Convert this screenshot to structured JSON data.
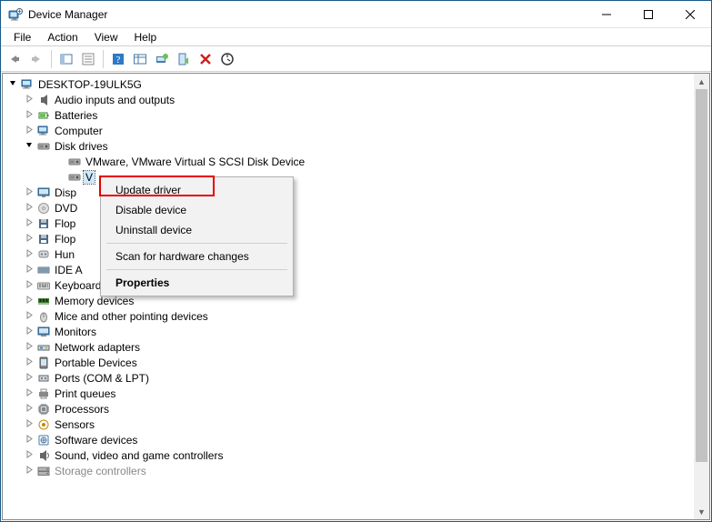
{
  "window": {
    "title": "Device Manager"
  },
  "menubar": {
    "items": [
      "File",
      "Action",
      "View",
      "Help"
    ]
  },
  "toolbar": {
    "buttons": [
      {
        "name": "back-icon"
      },
      {
        "name": "forward-icon"
      },
      {
        "sep": true
      },
      {
        "name": "show-hidden-icon"
      },
      {
        "name": "properties-icon"
      },
      {
        "sep": true
      },
      {
        "name": "help-icon"
      },
      {
        "name": "view-icon"
      },
      {
        "name": "monitor-icon"
      },
      {
        "name": "device-manager-icon"
      },
      {
        "name": "delete-icon"
      },
      {
        "name": "scan-refresh-icon"
      }
    ]
  },
  "tree": {
    "root": "DESKTOP-19ULK5G",
    "items": [
      {
        "label": "Audio inputs and outputs",
        "icon": "audio"
      },
      {
        "label": "Batteries",
        "icon": "battery"
      },
      {
        "label": "Computer",
        "icon": "computer"
      },
      {
        "label": "Disk drives",
        "icon": "disk",
        "open": true,
        "children": [
          {
            "label": "VMware, VMware Virtual S SCSI Disk Device",
            "icon": "disk"
          },
          {
            "label": "V",
            "icon": "disk",
            "selected": true
          }
        ]
      },
      {
        "label": "Disp",
        "icon": "display",
        "truncated": true
      },
      {
        "label": "DVD",
        "icon": "dvd",
        "truncated": true
      },
      {
        "label": "Flop",
        "icon": "floppy",
        "truncated": true
      },
      {
        "label": "Flop",
        "icon": "floppy",
        "truncated": true
      },
      {
        "label": "Hun",
        "icon": "hid",
        "truncated": true
      },
      {
        "label": "IDE A",
        "icon": "ide",
        "truncated": true
      },
      {
        "label": "Keyboards",
        "icon": "keyboard"
      },
      {
        "label": "Memory devices",
        "icon": "memory"
      },
      {
        "label": "Mice and other pointing devices",
        "icon": "mouse"
      },
      {
        "label": "Monitors",
        "icon": "monitor"
      },
      {
        "label": "Network adapters",
        "icon": "network"
      },
      {
        "label": "Portable Devices",
        "icon": "portable"
      },
      {
        "label": "Ports (COM & LPT)",
        "icon": "port"
      },
      {
        "label": "Print queues",
        "icon": "printer"
      },
      {
        "label": "Processors",
        "icon": "cpu"
      },
      {
        "label": "Sensors",
        "icon": "sensor"
      },
      {
        "label": "Software devices",
        "icon": "software"
      },
      {
        "label": "Sound, video and game controllers",
        "icon": "sound"
      },
      {
        "label": "Storage controllers",
        "icon": "storage",
        "cut": true
      }
    ]
  },
  "context_menu": {
    "items": [
      {
        "label": "Update driver",
        "highlight": true
      },
      {
        "label": "Disable device"
      },
      {
        "label": "Uninstall device"
      },
      {
        "sep": true
      },
      {
        "label": "Scan for hardware changes"
      },
      {
        "sep": true
      },
      {
        "label": "Properties",
        "bold": true
      }
    ]
  }
}
